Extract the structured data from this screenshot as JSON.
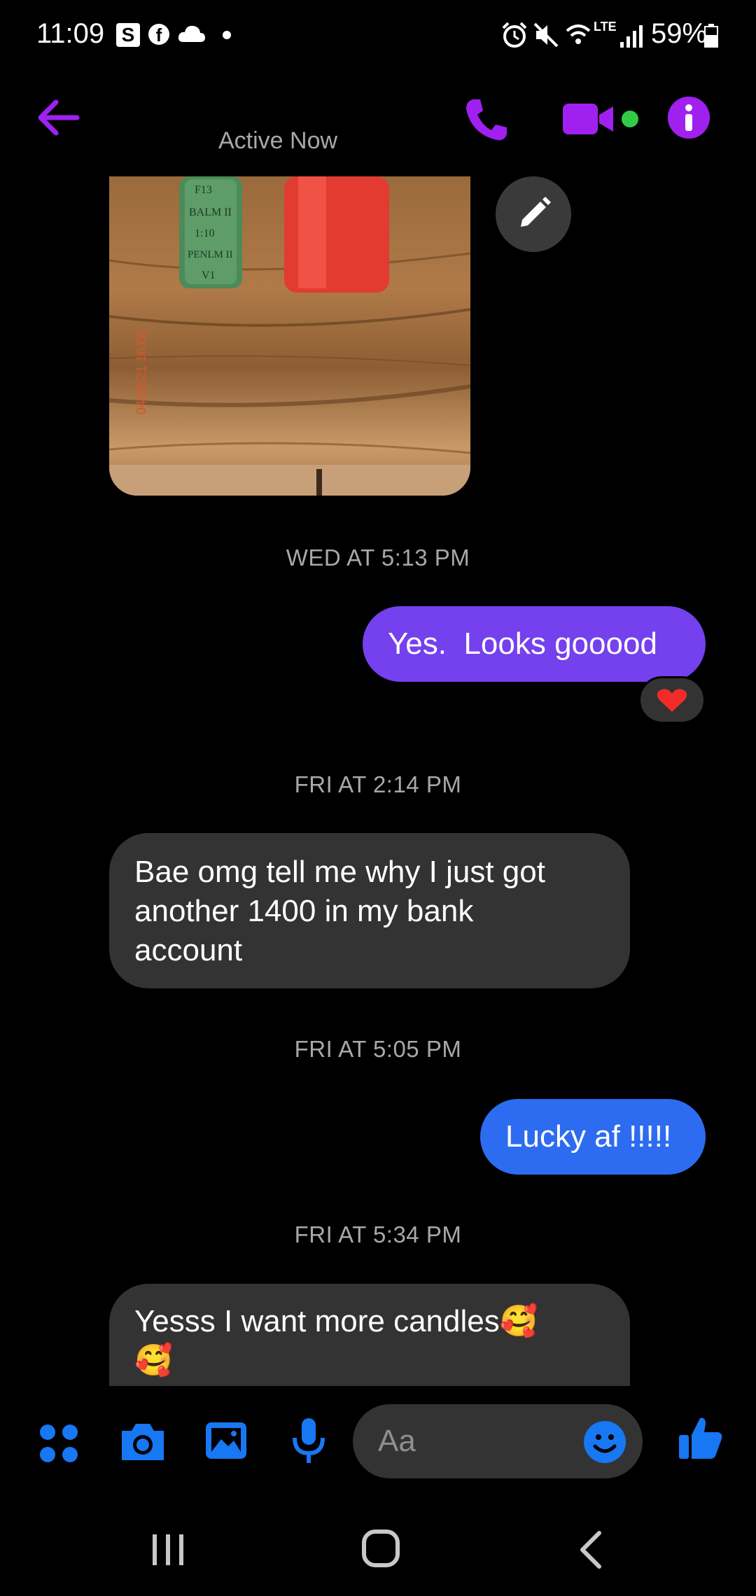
{
  "status_bar": {
    "time": "11:09",
    "s_badge": "S",
    "fb_badge": "f",
    "lte": "LTE",
    "battery": "59%"
  },
  "header": {
    "active_status": "Active Now",
    "accent_color": "#a020f0",
    "active_dot_color": "#31cc46"
  },
  "photo": {
    "bottle_label_lines": [
      "F13",
      "BALM II",
      "1:10",
      "PENLM II",
      "V1"
    ],
    "date_stamp": "04/16/21 16:00"
  },
  "messages": [
    {
      "type": "timestamp",
      "text": "WED AT 5:13 PM"
    },
    {
      "type": "sent",
      "text": "Yes.  Looks gooood",
      "color": "#7540ee",
      "reaction": "❤️"
    },
    {
      "type": "timestamp",
      "text": "FRI AT 2:14 PM"
    },
    {
      "type": "received",
      "lines": [
        "Bae omg tell me why I just got",
        "another 1400 in my bank",
        "account"
      ]
    },
    {
      "type": "timestamp",
      "text": "FRI AT 5:05 PM"
    },
    {
      "type": "sent",
      "text": "Lucky af !!!!!",
      "color": "#2d6cf0"
    },
    {
      "type": "timestamp",
      "text": "FRI AT 5:34 PM"
    },
    {
      "type": "received",
      "lines": [
        "Yesss I want more candles🥰",
        "🥰"
      ]
    }
  ],
  "composer": {
    "placeholder": "Aa",
    "icon_color": "#1877f2",
    "icons": [
      "apps-icon",
      "camera-icon",
      "gallery-icon",
      "microphone-icon",
      "emoji-icon",
      "like-icon"
    ]
  }
}
